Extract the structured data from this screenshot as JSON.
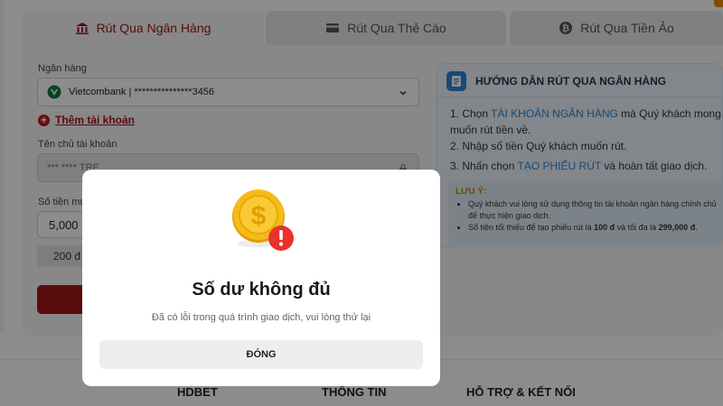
{
  "tabs": [
    {
      "label": "Rút Qua Ngân Hàng",
      "icon": "bank-icon",
      "active": true
    },
    {
      "label": "Rút Qua Thẻ Cào",
      "icon": "card-icon",
      "active": false
    },
    {
      "label": "Rút Qua Tiền Ảo",
      "icon": "bitcoin-icon",
      "active": false
    }
  ],
  "form": {
    "bank_label": "Ngân hàng",
    "bank_value": "Vietcombank | ***************3456",
    "add_account": "Thêm tài khoản",
    "holder_label": "Tên chủ tài khoản",
    "holder_value": "*** **** TRE",
    "amount_label": "Số tiền mu",
    "amount_value": "5,000",
    "chip": "200 đ"
  },
  "guide": {
    "title": "HƯỚNG DẪN RÚT QUA NGÂN HÀNG",
    "step1_pre": "1. Chọn ",
    "step1_hl": "TÀI KHOẢN NGÂN HÀNG",
    "step1_post": " mà Quý khách mong muốn rút tiền về.",
    "step2": "2. Nhập số tiền Quý khách muốn rút.",
    "step3_pre": "3. Nhấn chọn ",
    "step3_hl": "TẠO PHIẾU RÚT",
    "step3_post": " và hoàn tất giao dịch.",
    "note_title": "LƯU Ý:",
    "note1": "Quý khách vui lòng sử dụng thông tin tài khoản ngân hàng chính chủ để thực hiện giao dịch.",
    "note2_pre": "Số tiền tối thiểu để tạo phiếu rút là ",
    "note2_min": "100 đ",
    "note2_mid": " và tối đa là ",
    "note2_max": "299,000 đ",
    "note2_end": "."
  },
  "footer": {
    "col1": "HDBET",
    "col2": "THÔNG TIN",
    "col3": "HỖ TRỢ & KẾT NỐI"
  },
  "modal": {
    "title": "Số dư không đủ",
    "message": "Đã có lỗi trong quá trình giao dịch, vui lòng thử lại",
    "close": "ĐÓNG",
    "icon": "coin-warning-icon"
  },
  "colors": {
    "brand": "#a1161b",
    "accent_blue": "#2f86d6",
    "alert_red": "#e8322b",
    "coin_gold": "#f2b600"
  }
}
